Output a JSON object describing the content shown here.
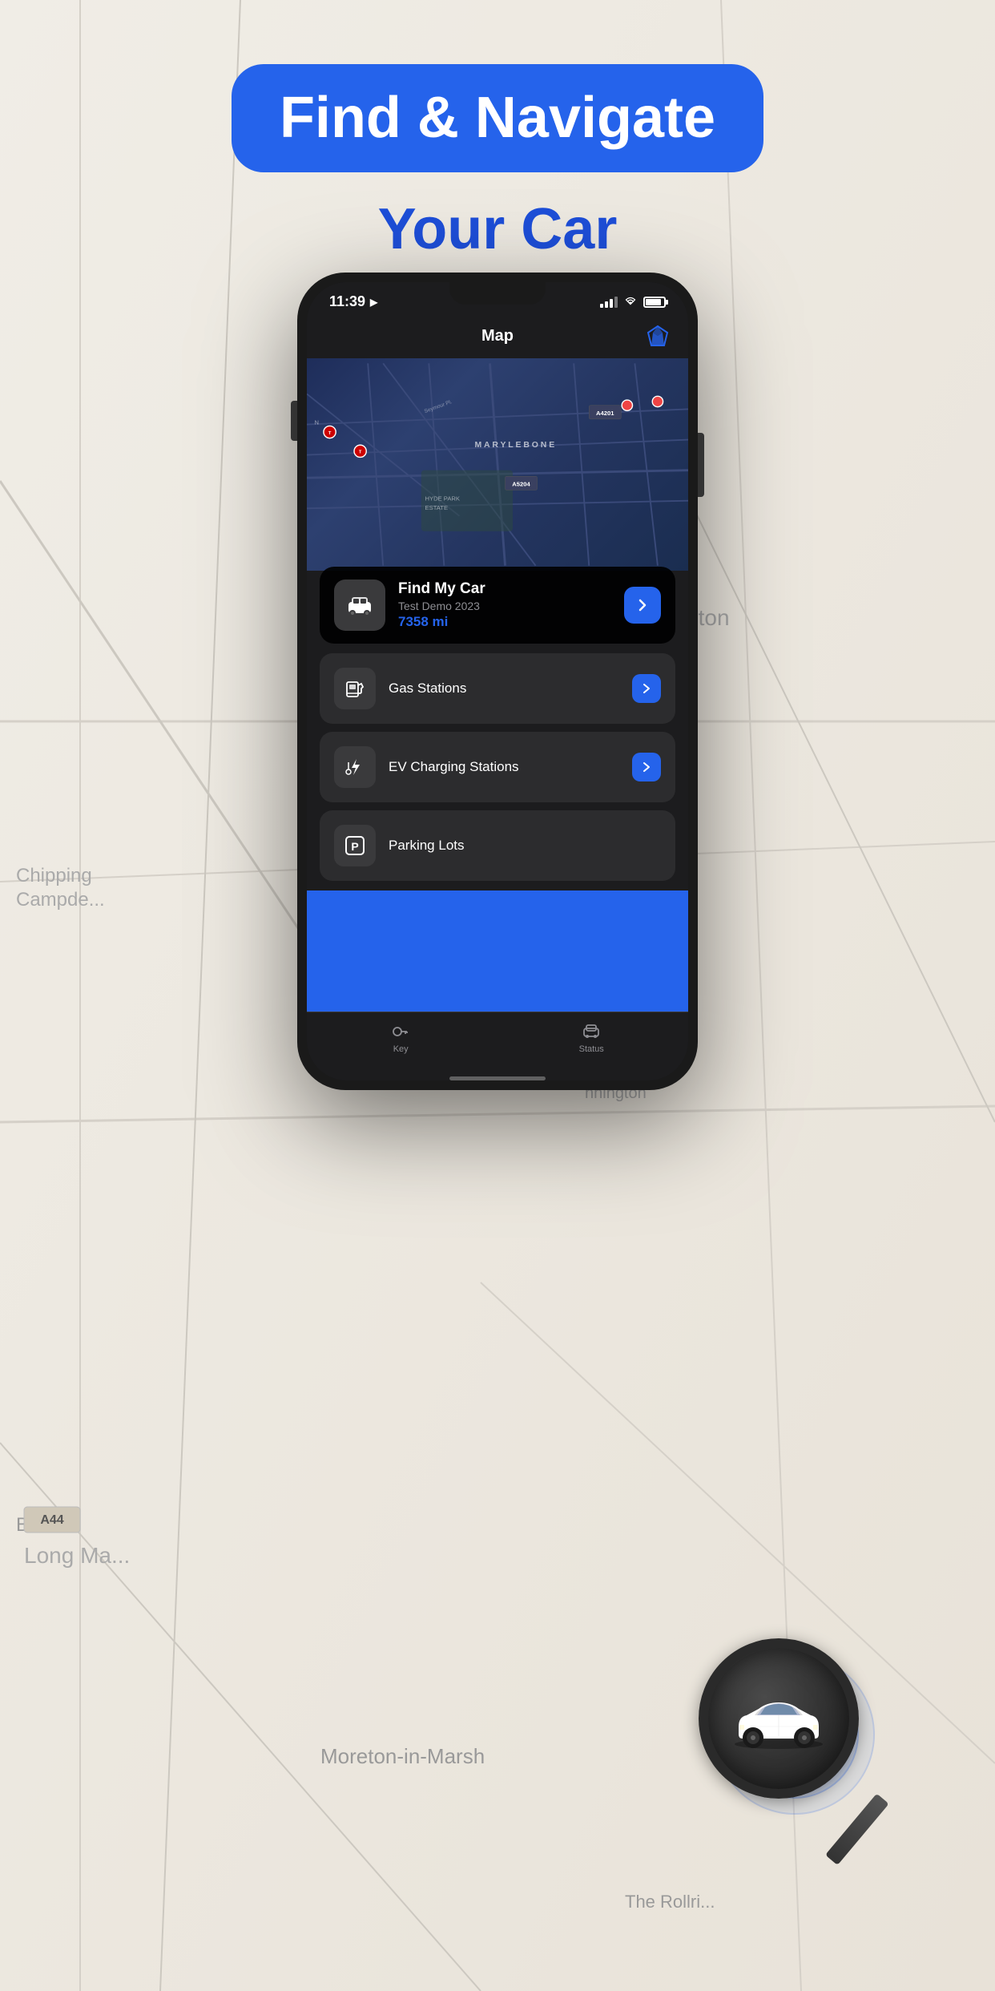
{
  "header": {
    "badge_text": "Find & Navigate",
    "subtitle": "Your Car"
  },
  "phone": {
    "status_bar": {
      "time": "11:39",
      "nav_icon": "▶"
    },
    "app_title": "Map",
    "map_label": "MARYLEBONE",
    "find_car": {
      "title": "Find My Car",
      "subtitle": "Test Demo 2023",
      "distance": "7358 mi",
      "arrow_icon": "›"
    },
    "menu_items": [
      {
        "id": "gas-stations",
        "label": "Gas Stations",
        "icon": "gas"
      },
      {
        "id": "ev-charging",
        "label": "EV Charging Stations",
        "icon": "ev"
      },
      {
        "id": "parking",
        "label": "Parking Lots",
        "icon": "parking"
      }
    ],
    "bottom_nav": [
      {
        "id": "key",
        "label": "Key",
        "icon": "key"
      },
      {
        "id": "status",
        "label": "Status",
        "icon": "car"
      }
    ]
  },
  "colors": {
    "accent": "#2563eb",
    "dark_bg": "#1c1c1e",
    "card_bg": "#2c2c2e",
    "icon_bg": "#3a3a3c",
    "distance_color": "#2563eb"
  }
}
